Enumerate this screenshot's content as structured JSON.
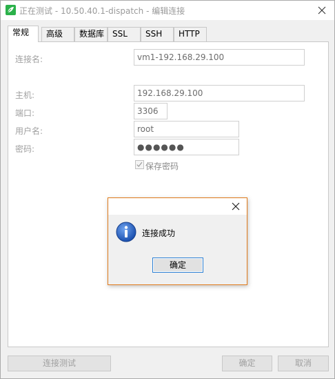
{
  "window": {
    "title": "正在测试 - 10.50.40.1-dispatch - 编辑连接",
    "icon": "navicat-leaf-icon",
    "accent_color": "#2bb14a"
  },
  "tabs": [
    {
      "label": "常规",
      "active": true
    },
    {
      "label": "高级",
      "active": false
    },
    {
      "label": "数据库",
      "active": false
    },
    {
      "label": "SSL",
      "active": false
    },
    {
      "label": "SSH",
      "active": false
    },
    {
      "label": "HTTP",
      "active": false
    }
  ],
  "form": {
    "connection_name_label": "连接名:",
    "connection_name_value": "vm1-192.168.29.100",
    "host_label": "主机:",
    "host_value": "192.168.29.100",
    "port_label": "端口:",
    "port_value": "3306",
    "username_label": "用户名:",
    "username_value": "root",
    "password_label": "密码:",
    "password_value": "●●●●●●",
    "save_password_label": "保存密码",
    "save_password_checked": true
  },
  "buttons": {
    "test_connection": "连接测试",
    "ok": "确定",
    "cancel": "取消"
  },
  "dialog": {
    "message": "连接成功",
    "ok_label": "确定",
    "icon": "info-icon",
    "border_color": "#e07a1a"
  }
}
